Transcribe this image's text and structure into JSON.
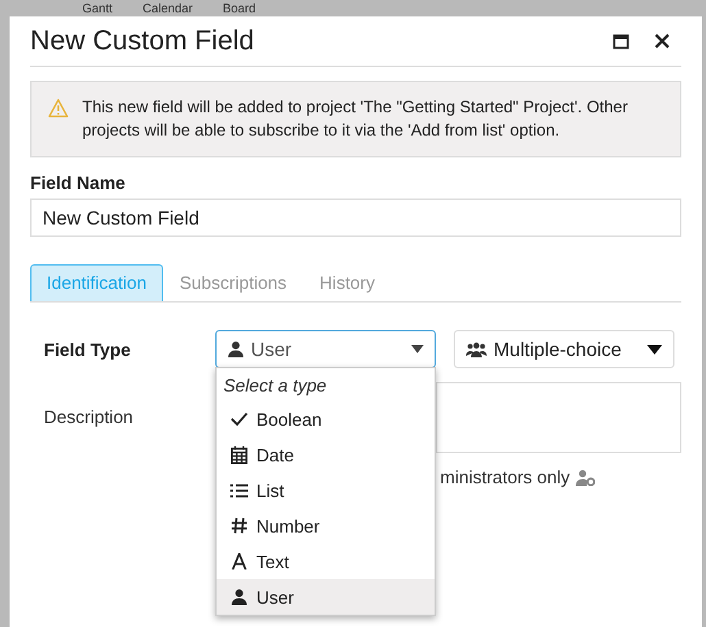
{
  "background_nav": [
    "Gantt",
    "Calendar",
    "Board"
  ],
  "dialog": {
    "title": "New Custom Field"
  },
  "notice": {
    "text": "This new field will be added to project 'The \"Getting Started\" Project'. Other projects will be able to subscribe to it via the 'Add from list' option."
  },
  "field_name": {
    "label": "Field Name",
    "value": "New Custom Field"
  },
  "tabs": [
    {
      "label": "Identification",
      "selected": true
    },
    {
      "label": "Subscriptions",
      "selected": false
    },
    {
      "label": "History",
      "selected": false
    }
  ],
  "field_type": {
    "label": "Field Type",
    "value": "User",
    "cardinality": "Multiple-choice"
  },
  "description": {
    "label": "Description"
  },
  "visibility_note": {
    "text": "ministrators only"
  },
  "type_menu": {
    "header": "Select a type",
    "items": [
      {
        "label": "Boolean",
        "kind": "check",
        "selected": false
      },
      {
        "label": "Date",
        "kind": "calendar",
        "selected": false
      },
      {
        "label": "List",
        "kind": "list",
        "selected": false
      },
      {
        "label": "Number",
        "kind": "hash",
        "selected": false
      },
      {
        "label": "Text",
        "kind": "letter",
        "selected": false
      },
      {
        "label": "User",
        "kind": "user",
        "selected": true
      }
    ]
  }
}
